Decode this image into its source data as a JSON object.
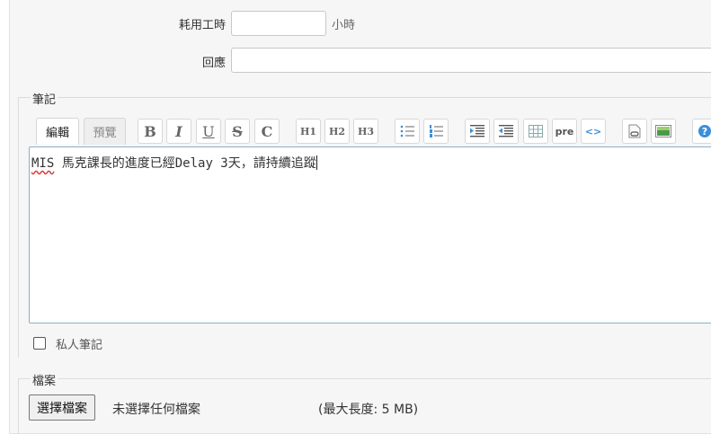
{
  "time_field": {
    "label": "耗用工時",
    "value": "",
    "unit": "小時"
  },
  "reply_field": {
    "label": "回應",
    "value": ""
  },
  "notes": {
    "legend": "筆記",
    "tabs": [
      {
        "label": "編輯",
        "active": true
      },
      {
        "label": "預覽",
        "active": false
      }
    ],
    "toolbar": {
      "bold": "B",
      "italic": "I",
      "underline": "U",
      "strike": "S",
      "code": "C",
      "h1": "H1",
      "h2": "H2",
      "h3": "H3",
      "pre": "pre",
      "html": "<>",
      "help": "?"
    },
    "editor": {
      "spell_word": "MIS",
      "text": " 馬克課長的進度已經Delay 3天，請持續追蹤"
    },
    "private": {
      "label": "私人筆記",
      "checked": false
    }
  },
  "files": {
    "legend": "檔案",
    "choose_button": "選擇檔案",
    "no_file": "未選擇任何檔案",
    "max_size": "(最大長度: 5 MB)"
  },
  "colors": {
    "editor_border": "#8ab0c8",
    "toolbar_blue": "#3a8fd6",
    "panel_bg": "#f6f6f6"
  }
}
